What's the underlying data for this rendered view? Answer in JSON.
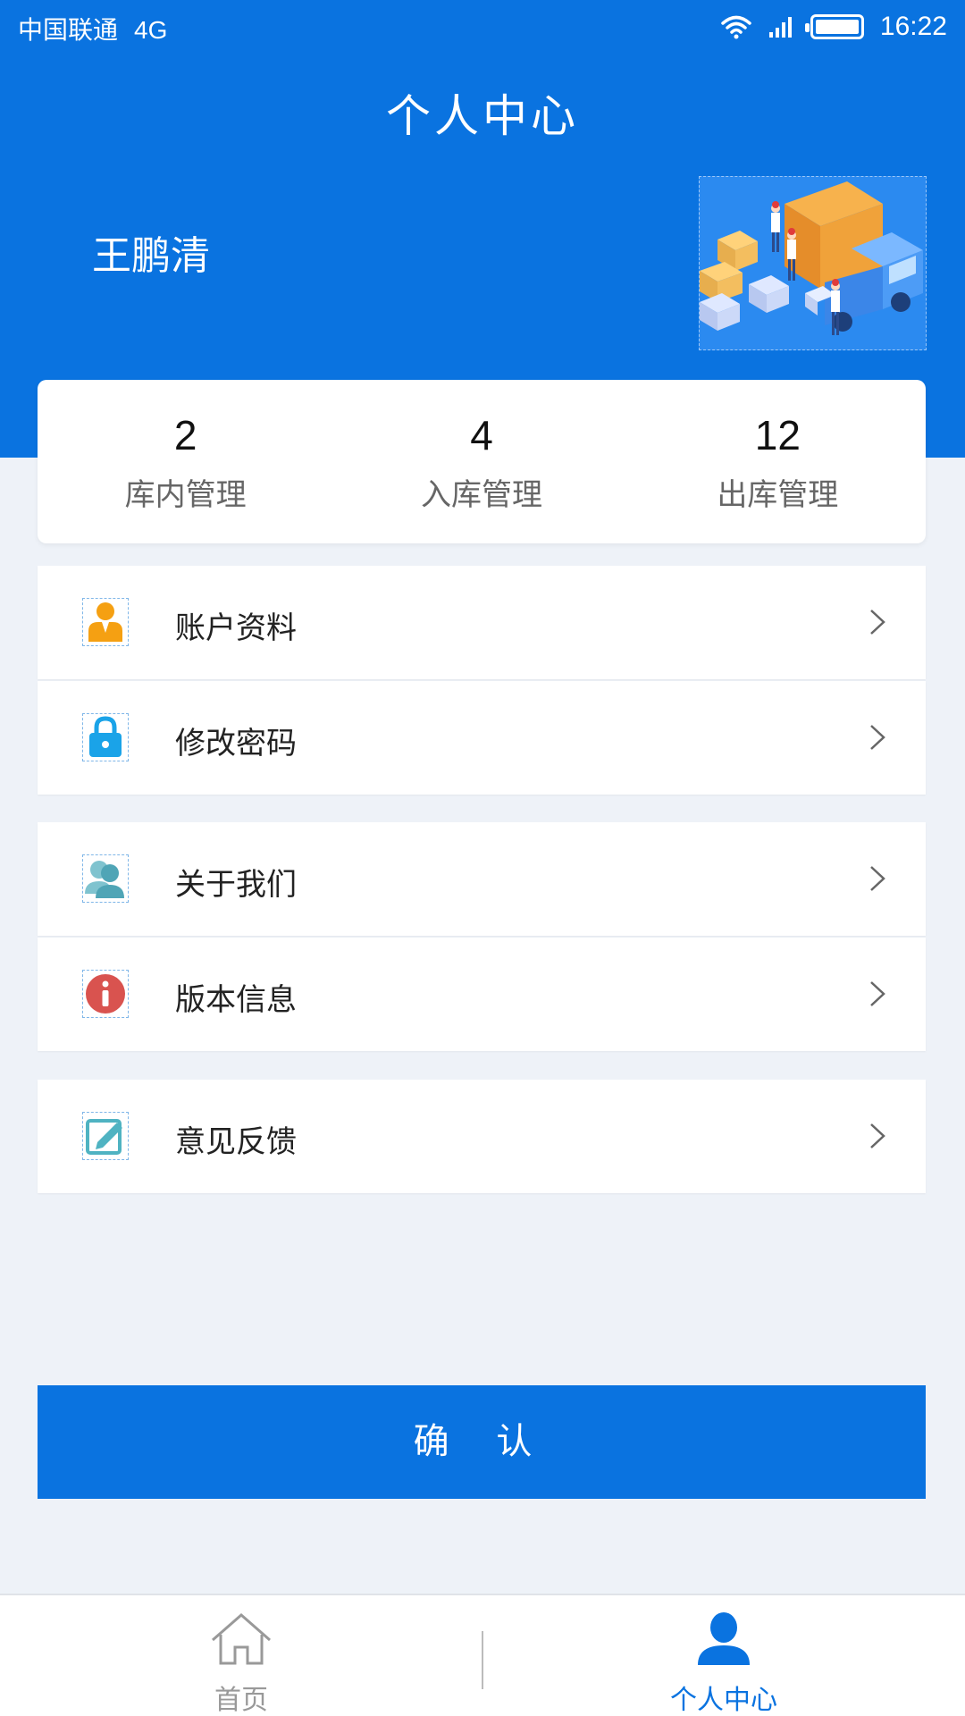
{
  "status_bar": {
    "carrier": "中国联通",
    "network": "4G",
    "time": "16:22"
  },
  "header": {
    "title": "个人中心",
    "user_name": "王鹏清"
  },
  "stats": [
    {
      "value": "2",
      "label": "库内管理"
    },
    {
      "value": "4",
      "label": "入库管理"
    },
    {
      "value": "12",
      "label": "出库管理"
    }
  ],
  "menu": [
    {
      "label": "账户资料",
      "icon": "user-profile-icon",
      "icon_color": "#f5a012"
    },
    {
      "label": "修改密码",
      "icon": "lock-icon",
      "icon_color": "#1aa3e8"
    },
    {
      "label": "关于我们",
      "icon": "users-icon",
      "icon_color": "#5aaabb"
    },
    {
      "label": "版本信息",
      "icon": "info-icon",
      "icon_color": "#d9534f"
    },
    {
      "label": "意见反馈",
      "icon": "feedback-edit-icon",
      "icon_color": "#4fb3c2"
    }
  ],
  "confirm_label": "确 认",
  "bottom_nav": [
    {
      "label": "首页",
      "icon": "home-icon",
      "active": false
    },
    {
      "label": "个人中心",
      "icon": "user-icon",
      "active": true
    }
  ],
  "colors": {
    "primary": "#0a73e0",
    "background": "#eef2f8"
  }
}
